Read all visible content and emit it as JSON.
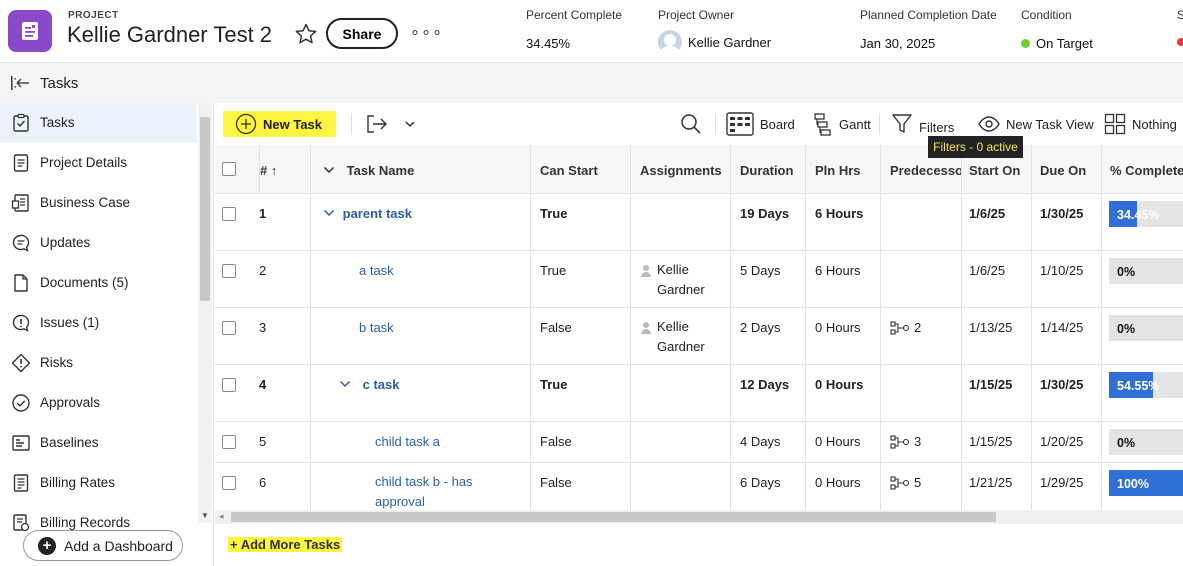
{
  "header": {
    "project_label": "PROJECT",
    "title": "Kellie Gardner Test 2",
    "share_label": "Share",
    "more_label": "∘∘∘",
    "percent_complete": {
      "label": "Percent Complete",
      "value": "34.45%"
    },
    "project_owner": {
      "label": "Project Owner",
      "value": "Kellie Gardner"
    },
    "planned_completion": {
      "label": "Planned Completion Date",
      "value": "Jan 30, 2025"
    },
    "condition": {
      "label": "Condition",
      "value": "On Target",
      "color": "#6fcf2f"
    },
    "status": {
      "label": "S"
    }
  },
  "section": {
    "title": "Tasks"
  },
  "sidebar": {
    "items": [
      {
        "label": "Tasks",
        "icon": "tasks-icon",
        "active": true
      },
      {
        "label": "Project Details",
        "icon": "project-details-icon"
      },
      {
        "label": "Business Case",
        "icon": "business-case-icon"
      },
      {
        "label": "Updates",
        "icon": "updates-icon"
      },
      {
        "label": "Documents (5)",
        "icon": "documents-icon"
      },
      {
        "label": "Issues (1)",
        "icon": "issues-icon"
      },
      {
        "label": "Risks",
        "icon": "risks-icon"
      },
      {
        "label": "Approvals",
        "icon": "approvals-icon"
      },
      {
        "label": "Baselines",
        "icon": "baselines-icon"
      },
      {
        "label": "Billing Rates",
        "icon": "billing-rates-icon"
      },
      {
        "label": "Billing Records",
        "icon": "billing-records-icon"
      }
    ],
    "add_dashboard_label": "Add a Dashboard"
  },
  "toolbar": {
    "new_task": "New Task",
    "board": "Board",
    "gantt": "Gantt",
    "filters": "Filters",
    "new_task_view": "New Task View",
    "nothing": "Nothing",
    "tooltip": "Filters - 0 active",
    "highlight_color": "#fdf53f"
  },
  "table": {
    "headers": {
      "num": "#",
      "task_name": "Task Name",
      "can_start": "Can Start",
      "assignments": "Assignments",
      "duration": "Duration",
      "pln_hrs": "Pln Hrs",
      "predecessors": "Predecessors",
      "start_on": "Start On",
      "due_on": "Due On",
      "pct_complete": "% Complete"
    },
    "rows": [
      {
        "num": "1",
        "name": "parent task",
        "can_start": "True",
        "assign1": "",
        "assign2": "",
        "duration": "19 Days",
        "pln_hrs": "6 Hours",
        "pred": "",
        "start": "1/6/25",
        "due": "1/30/25",
        "pct": "34.45%",
        "pct_value": 34.45
      },
      {
        "num": "2",
        "name": "a task",
        "can_start": "True",
        "assign1": "Kellie",
        "assign2": "Gardner",
        "duration": "5 Days",
        "pln_hrs": "6 Hours",
        "pred": "",
        "start": "1/6/25",
        "due": "1/10/25",
        "pct": "0%",
        "pct_value": 0
      },
      {
        "num": "3",
        "name": "b task",
        "can_start": "False",
        "assign1": "Kellie",
        "assign2": "Gardner",
        "duration": "2 Days",
        "pln_hrs": "0 Hours",
        "pred": "2",
        "start": "1/13/25",
        "due": "1/14/25",
        "pct": "0%",
        "pct_value": 0
      },
      {
        "num": "4",
        "name": "c task",
        "can_start": "True",
        "assign1": "",
        "assign2": "",
        "duration": "12 Days",
        "pln_hrs": "0 Hours",
        "pred": "",
        "start": "1/15/25",
        "due": "1/30/25",
        "pct": "54.55%",
        "pct_value": 54.55
      },
      {
        "num": "5",
        "name": "child task a",
        "can_start": "False",
        "assign1": "",
        "assign2": "",
        "duration": "4 Days",
        "pln_hrs": "0 Hours",
        "pred": "3",
        "start": "1/15/25",
        "due": "1/20/25",
        "pct": "0%",
        "pct_value": 0
      },
      {
        "num": "6",
        "name": "child task b - has approval",
        "can_start": "False",
        "assign1": "",
        "assign2": "",
        "duration": "6 Days",
        "pln_hrs": "0 Hours",
        "pred": "5",
        "start": "1/21/25",
        "due": "1/29/25",
        "pct": "100%",
        "pct_value": 100
      }
    ]
  },
  "footer": {
    "add_more_tasks": "+ Add More Tasks"
  }
}
